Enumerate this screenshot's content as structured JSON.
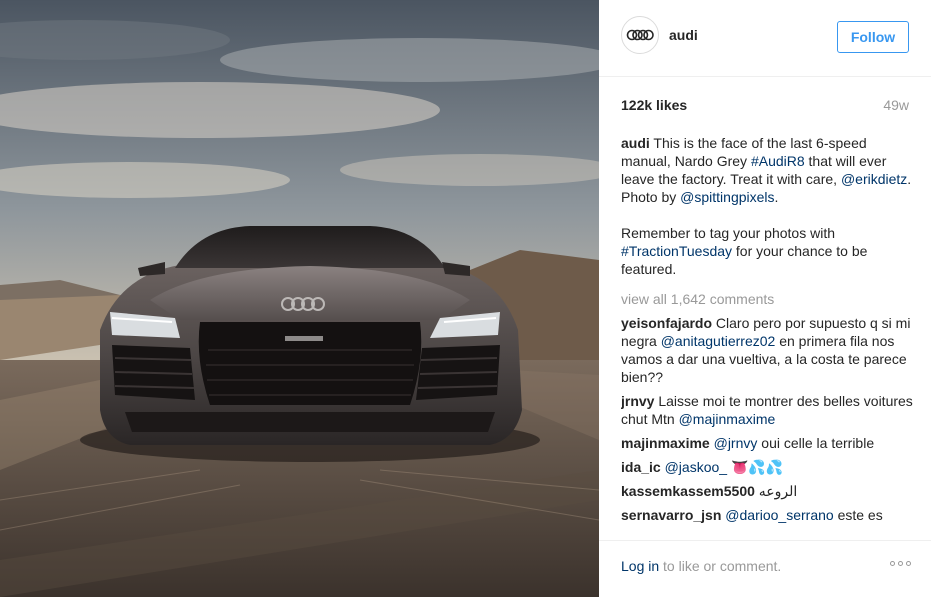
{
  "post": {
    "image_alt": "Grey Audi R8 driving on a desert road under a cloudy sky",
    "brand_grille_logo": "audi-rings-logo"
  },
  "header": {
    "avatar_icon": "audi-rings-logo",
    "username": "audi",
    "follow_label": "Follow"
  },
  "stats": {
    "likes": "122k likes",
    "time": "49w"
  },
  "caption": {
    "user": "audi",
    "text1": "This is the face of the last 6-speed manual, Nardo Grey ",
    "tag1": "#AudiR8",
    "text2": " that will ever leave the factory. Treat it with care, ",
    "tag2": "@erikdietz",
    "text3": ". Photo by ",
    "tag3": "@spittingpixels",
    "text4": ".",
    "para2_text1": "Remember to tag your photos with ",
    "para2_tag": "#TractionTuesday",
    "para2_text2": " for your chance to be featured."
  },
  "view_all": "view all 1,642 comments",
  "comments": [
    {
      "user": "yeisonfajardo",
      "pre": "Claro pero por supuesto q si mi negra ",
      "tag": "@anitagutierrez02",
      "post": " en primera fila nos vamos a dar una vueltiva, a la costa te parece bien??"
    },
    {
      "user": "jrnvy",
      "pre": "Laisse moi te montrer des belles voitures chut Mtn ",
      "tag": "@majinmaxime",
      "post": ""
    },
    {
      "user": "majinmaxime",
      "pre": "",
      "tag": "@jrnvy",
      "post": " oui celle la terrible"
    },
    {
      "user": "ida_ic",
      "pre": "",
      "tag": "@jaskoo_",
      "post": " ",
      "emoji": "👅",
      "emoji2": "💦💦"
    },
    {
      "user": "kassemkassem5500",
      "pre": "الروعه",
      "tag": "",
      "post": ""
    },
    {
      "user": "sernavarro_jsn",
      "pre": "",
      "tag": "@darioo_serrano",
      "post": " este es"
    }
  ],
  "footer": {
    "login_link": "Log in",
    "login_rest": " to like or comment.",
    "more_icon": "more-options-icon"
  },
  "colors": {
    "accent": "#3897f0",
    "link": "#003569",
    "muted": "#999999",
    "text": "#262626",
    "border": "#efefef"
  }
}
